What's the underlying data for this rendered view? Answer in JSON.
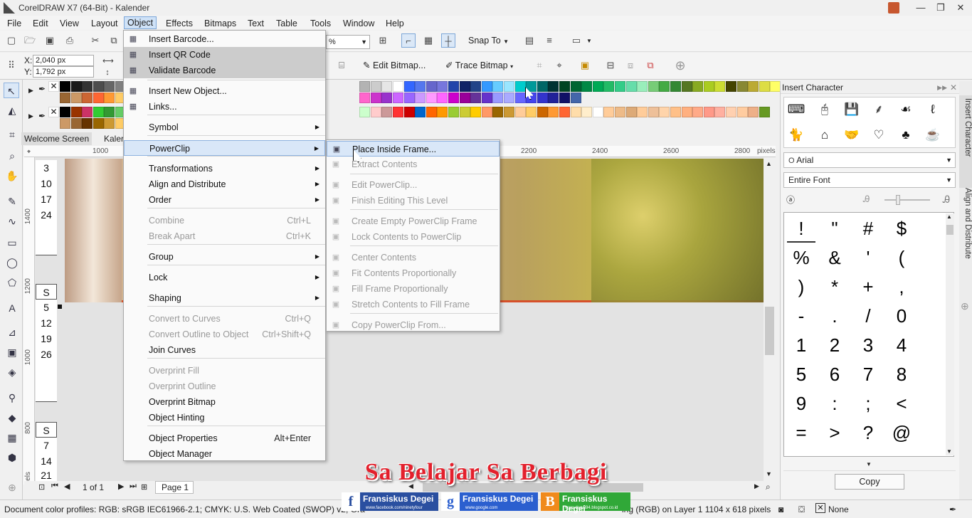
{
  "window": {
    "title": "CorelDRAW X7 (64-Bit) - Kalender"
  },
  "menubar": [
    "File",
    "Edit",
    "View",
    "Layout",
    "Object",
    "Effects",
    "Bitmaps",
    "Text",
    "Table",
    "Tools",
    "Window",
    "Help"
  ],
  "toolbar": {
    "zoom_value": "%",
    "snap_to": "Snap To",
    "x_label": "X:",
    "x_value": "2,040 px",
    "y_label": "Y:",
    "y_value": "1,792 px",
    "edit_bitmap": "Edit Bitmap...",
    "trace_bitmap": "Trace Bitmap"
  },
  "tabs": [
    "Welcome Screen",
    "Kaler"
  ],
  "ruler": {
    "h_labels": [
      "1000",
      "2200",
      "2400",
      "2600",
      "2800"
    ],
    "h_unit": "pixels",
    "v_labels": [
      "1400",
      "1200",
      "1000",
      "800"
    ],
    "v_unit": "pixels"
  },
  "calendar_cells": [
    "3",
    "10",
    "17",
    "24",
    "S",
    "5",
    "12",
    "19",
    "26",
    "S",
    "7",
    "14",
    "21"
  ],
  "object_menu": {
    "items": [
      {
        "label": "Insert Barcode...",
        "icon": "barcode-icon"
      },
      {
        "label": "Insert QR Code",
        "icon": "qr-code-icon",
        "state": "highlight"
      },
      {
        "label": "Validate Barcode",
        "icon": "search-icon",
        "state": "highlight"
      },
      {
        "label": "Insert New Object...",
        "icon": "new-object-icon"
      },
      {
        "label": "Links...",
        "icon": "ole-icon"
      },
      {
        "label": "Symbol",
        "submenu": true
      },
      {
        "label": "PowerClip",
        "submenu": true,
        "state": "selected"
      },
      {
        "label": "Transformations",
        "submenu": true
      },
      {
        "label": "Align and Distribute",
        "submenu": true
      },
      {
        "label": "Order",
        "submenu": true
      },
      {
        "label": "Combine",
        "shortcut": "Ctrl+L",
        "disabled": true
      },
      {
        "label": "Break Apart",
        "shortcut": "Ctrl+K",
        "disabled": true
      },
      {
        "label": "Group",
        "submenu": true
      },
      {
        "label": "Lock",
        "submenu": true
      },
      {
        "label": "Shaping",
        "submenu": true
      },
      {
        "label": "Convert to Curves",
        "shortcut": "Ctrl+Q",
        "disabled": true
      },
      {
        "label": "Convert Outline to Object",
        "shortcut": "Ctrl+Shift+Q",
        "disabled": true
      },
      {
        "label": "Join Curves"
      },
      {
        "label": "Overprint Fill",
        "disabled": true
      },
      {
        "label": "Overprint Outline",
        "disabled": true
      },
      {
        "label": "Overprint Bitmap"
      },
      {
        "label": "Object Hinting"
      },
      {
        "label": "Object Properties",
        "shortcut": "Alt+Enter"
      },
      {
        "label": "Object Manager"
      }
    ]
  },
  "powerclip_menu": {
    "items": [
      {
        "label": "Place Inside Frame...",
        "state": "hover"
      },
      {
        "label": "Extract Contents",
        "disabled": true
      },
      {
        "label": "Edit PowerClip...",
        "disabled": true
      },
      {
        "label": "Finish Editing This Level",
        "disabled": true
      },
      {
        "label": "Create Empty PowerClip Frame",
        "disabled": true
      },
      {
        "label": "Lock Contents to PowerClip",
        "disabled": true
      },
      {
        "label": "Center Contents",
        "disabled": true
      },
      {
        "label": "Fit Contents Proportionally",
        "disabled": true
      },
      {
        "label": "Fill Frame Proportionally",
        "disabled": true
      },
      {
        "label": "Stretch Contents to Fill Frame",
        "disabled": true
      },
      {
        "label": "Copy PowerClip From...",
        "disabled": true
      }
    ]
  },
  "docker": {
    "title": "Insert Character",
    "font": "Arial",
    "subset": "Entire Font",
    "characters": [
      "!",
      "\"",
      "#",
      "$",
      "%",
      "&",
      "'",
      "(",
      ")",
      "*",
      "+",
      ",",
      "-",
      ".",
      "/",
      "0",
      "1",
      "2",
      "3",
      "4",
      "5",
      "6",
      "7",
      "8",
      "9",
      ":",
      ";",
      "<",
      "=",
      ">",
      "?",
      "@"
    ],
    "copy_label": "Copy",
    "vertical_tabs": [
      "Insert Character",
      "Align and Distribute"
    ]
  },
  "pagebar": {
    "page_count": "1 of 1",
    "page_tab": "Page 1"
  },
  "statusbar": {
    "left": "Document color profiles: RGB: sRGB IEC61966-2.1; CMYK: U.S. Web Coated (SWOP) v2; Gra",
    "right": "ing (RGB) on Layer 1 1104 x 618 pixels",
    "outline": "None"
  },
  "watermark": {
    "text": "Sa Belajar Sa Berbagi",
    "badges": [
      {
        "letter": "f",
        "name": "Fransiskus Degei",
        "url": "www.facebook.com/ninetyfour",
        "color": "#2a4fa0"
      },
      {
        "letter": "g",
        "name": "Fransiskus Degei",
        "url": "www.google.com",
        "color": "#2b5fcf"
      },
      {
        "letter": "B",
        "name": "Fransiskus Degei",
        "url": "www.degei94.blogspot.co.id",
        "color": "#30a838"
      }
    ]
  },
  "colors": {
    "accent": "#cfe2f7",
    "highlight": "#cccccc"
  }
}
